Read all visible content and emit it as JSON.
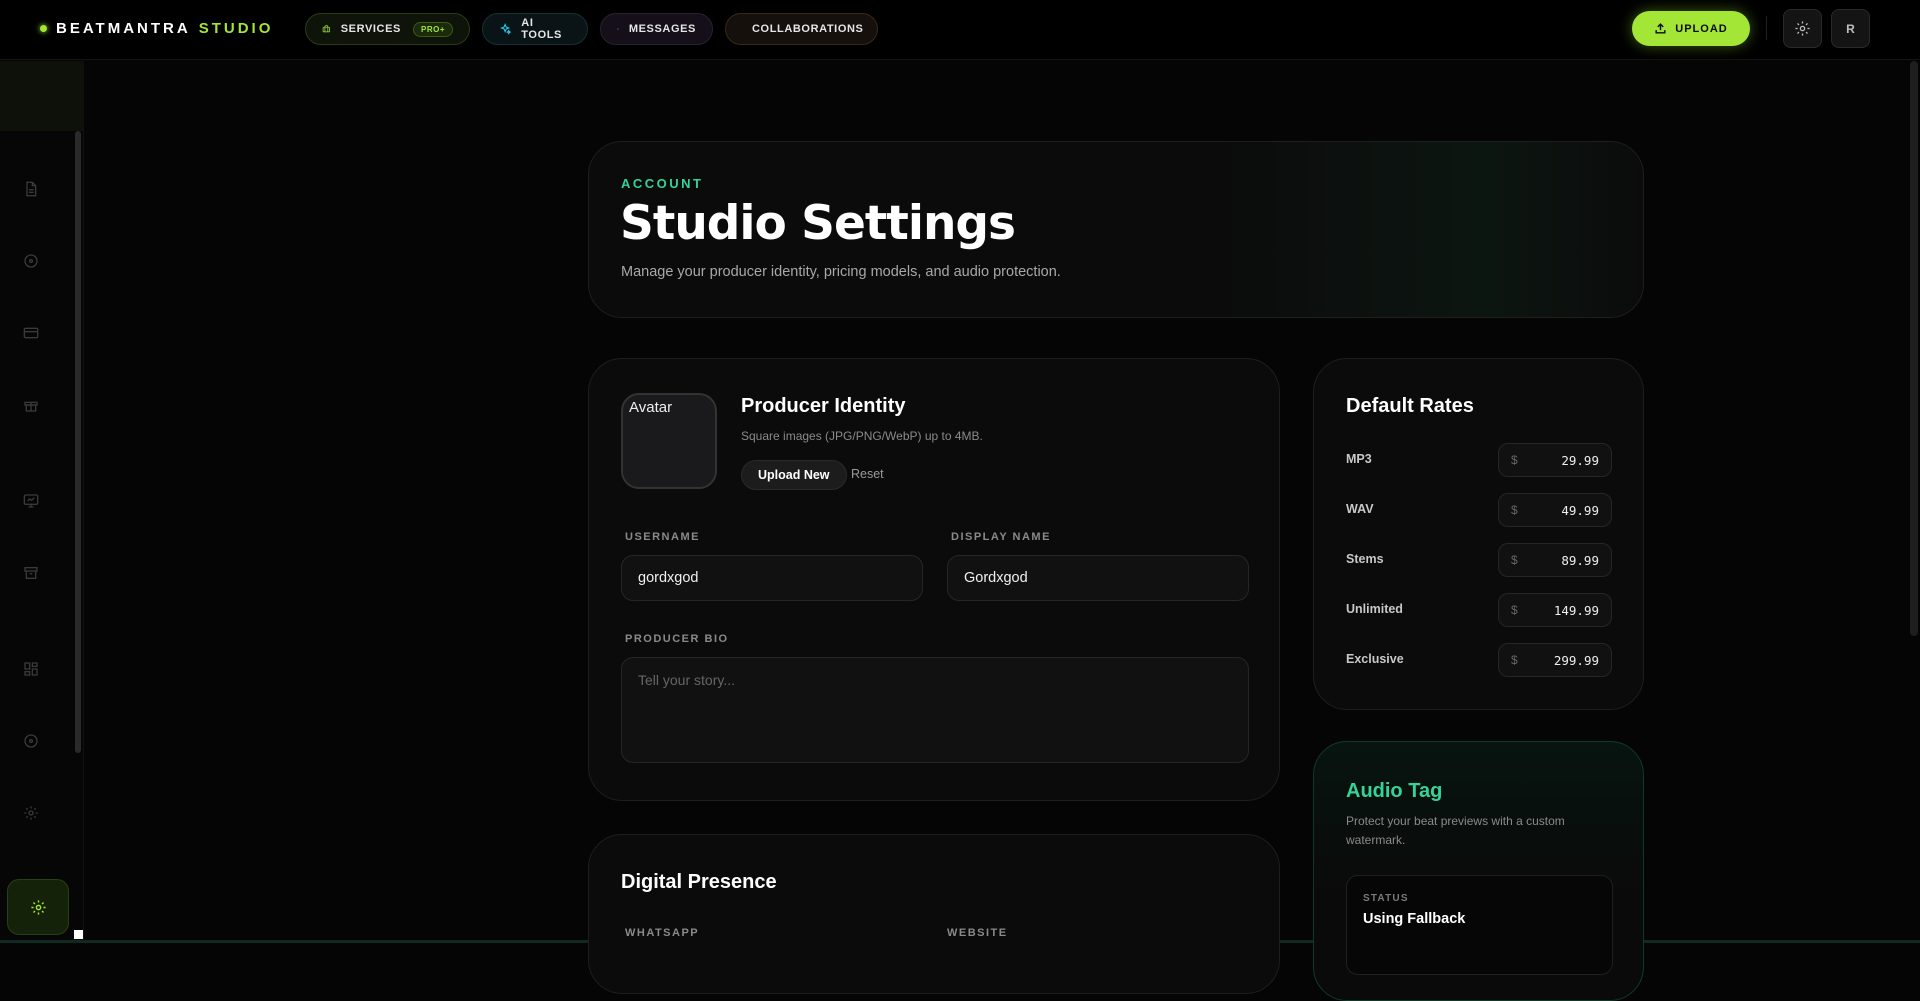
{
  "brand": {
    "name": "BEATMANTRA",
    "suffix": "STUDIO"
  },
  "nav": {
    "services": "SERVICES",
    "services_badge": "PRO+",
    "ai_tools": "AI TOOLS",
    "messages": "MESSAGES",
    "collaborations": "COLLABORATIONS"
  },
  "topbar": {
    "upload_label": "UPLOAD",
    "avatar_initial": "R"
  },
  "header": {
    "eyebrow": "ACCOUNT",
    "title": "Studio Settings",
    "subtitle": "Manage your producer identity, pricing models, and audio protection."
  },
  "identity": {
    "avatar_alt": "Avatar",
    "title": "Producer Identity",
    "subtitle": "Square images (JPG/PNG/WebP) up to 4MB.",
    "upload_label": "Upload New",
    "reset_label": "Reset",
    "username_label": "USERNAME",
    "username_value": "gordxgod",
    "display_name_label": "DISPLAY NAME",
    "display_name_value": "Gordxgod",
    "bio_label": "PRODUCER BIO",
    "bio_placeholder": "Tell your story..."
  },
  "presence": {
    "title": "Digital Presence",
    "whatsapp_label": "WHATSAPP",
    "website_label": "WEBSITE"
  },
  "rates": {
    "title": "Default Rates",
    "currency": "$",
    "items": [
      {
        "name": "MP3",
        "value": "29.99"
      },
      {
        "name": "WAV",
        "value": "49.99"
      },
      {
        "name": "Stems",
        "value": "89.99"
      },
      {
        "name": "Unlimited",
        "value": "149.99"
      },
      {
        "name": "Exclusive",
        "value": "299.99"
      }
    ]
  },
  "audio_tag": {
    "title": "Audio Tag",
    "subtitle": "Protect your beat previews with a custom watermark.",
    "status_label": "STATUS",
    "status_value": "Using Fallback"
  },
  "colors": {
    "accent": "#a3e635",
    "teal": "#34d399",
    "background": "#050505"
  }
}
